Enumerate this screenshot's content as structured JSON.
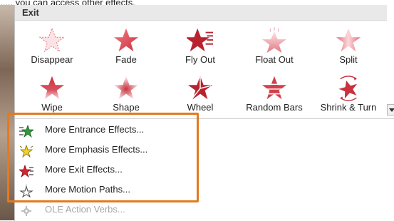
{
  "top_text": "...., you can access other effects.",
  "gallery": {
    "section_title": "Exit",
    "effects": [
      {
        "label": "Disappear",
        "icon": "disappear-star-icon"
      },
      {
        "label": "Fade",
        "icon": "fade-star-icon"
      },
      {
        "label": "Fly Out",
        "icon": "fly-out-star-icon"
      },
      {
        "label": "Float Out",
        "icon": "float-out-star-icon"
      },
      {
        "label": "Split",
        "icon": "split-star-icon"
      },
      {
        "label": "Wipe",
        "icon": "wipe-star-icon"
      },
      {
        "label": "Shape",
        "icon": "shape-star-icon"
      },
      {
        "label": "Wheel",
        "icon": "wheel-star-icon"
      },
      {
        "label": "Random Bars",
        "icon": "random-bars-star-icon"
      },
      {
        "label": "Shrink & Turn",
        "icon": "shrink-turn-star-icon"
      }
    ]
  },
  "menu": {
    "items": [
      {
        "label": "More Entrance Effects...",
        "icon": "green-star-icon",
        "enabled": true
      },
      {
        "label": "More Emphasis Effects...",
        "icon": "yellow-star-icon",
        "enabled": true
      },
      {
        "label": "More Exit Effects...",
        "icon": "red-star-icon",
        "enabled": true
      },
      {
        "label": "More Motion Paths...",
        "icon": "motion-path-star-icon",
        "enabled": true
      },
      {
        "label": "OLE Action Verbs...",
        "icon": "gear-icon",
        "enabled": false
      }
    ]
  },
  "colors": {
    "highlight": "#e37a1e",
    "exit_red": "#c9323e",
    "entrance_green": "#2e9b3a",
    "emphasis_yellow": "#f1d22c"
  }
}
